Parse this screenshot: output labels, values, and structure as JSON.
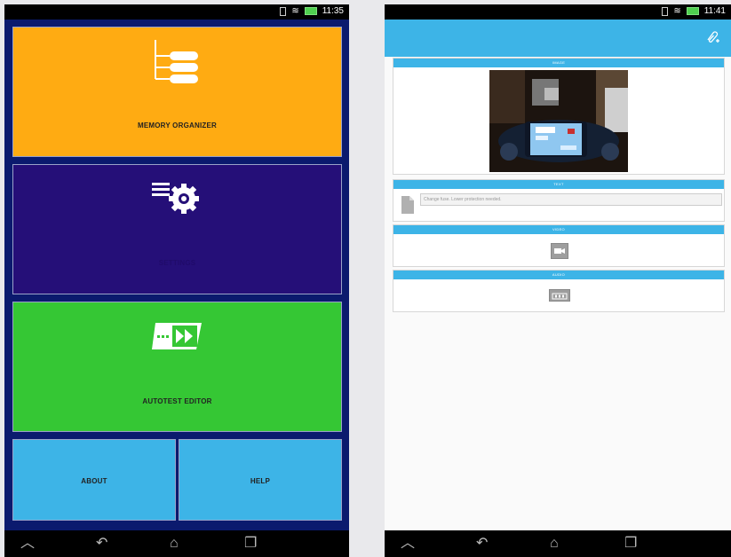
{
  "left": {
    "status_time": "11:35",
    "tiles": {
      "memory": "MEMORY ORGANIZER",
      "settings": "SETTINGS",
      "autotest": "AUTOTEST EDITOR",
      "about": "ABOUT",
      "help": "HELP"
    },
    "nav": {
      "home_up": "︿",
      "back": "↶",
      "home": "⌂",
      "recents": "❐"
    }
  },
  "right": {
    "status_time": "11:41",
    "sections": {
      "image": "IMAGE",
      "text": "TEXT",
      "video": "VIDEO",
      "audio": "AUDIO"
    },
    "text_value": "Change fuse. Lower protection needed."
  },
  "colors": {
    "memory_tile": "#ffab12",
    "settings_tile": "#250f78",
    "autotest_tile": "#35c734",
    "about_help_tile": "#3db4e7",
    "left_background": "#0b1a6e",
    "right_action_bar": "#3db4e7"
  },
  "icons": {
    "memory": "tree-list-icon",
    "settings": "list-gear-icon",
    "autotest": "fast-forward-card-icon",
    "attach": "paperclip-add-icon",
    "text_file": "document-icon",
    "video": "video-camera-icon",
    "audio": "audio-clip-icon"
  }
}
